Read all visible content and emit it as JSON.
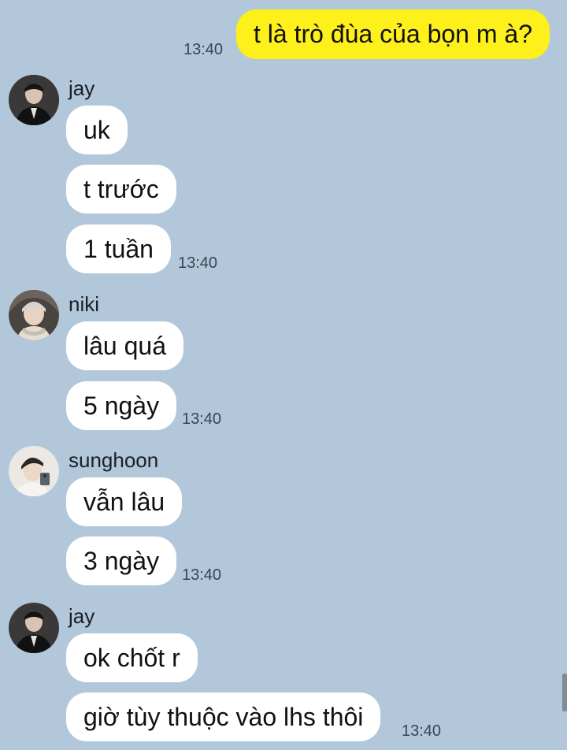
{
  "colors": {
    "background": "#b2c7da",
    "my_bubble": "#fef01b",
    "their_bubble": "#ffffff"
  },
  "outgoing": {
    "text": "t là trò đùa của bọn m à?",
    "time": "13:40"
  },
  "groups": [
    {
      "sender": "jay",
      "avatar_icon": "jay-avatar",
      "messages": [
        "uk",
        "t trước",
        "1 tuần"
      ],
      "time": "13:40"
    },
    {
      "sender": "niki",
      "avatar_icon": "niki-avatar",
      "messages": [
        "lâu quá",
        "5 ngày"
      ],
      "time": "13:40"
    },
    {
      "sender": "sunghoon",
      "avatar_icon": "sunghoon-avatar",
      "messages": [
        "vẫn lâu",
        "3 ngày"
      ],
      "time": "13:40"
    },
    {
      "sender": "jay",
      "avatar_icon": "jay-avatar",
      "messages": [
        "ok chốt r",
        "giờ tùy thuộc vào lhs thôi"
      ],
      "time": "13:40"
    }
  ]
}
